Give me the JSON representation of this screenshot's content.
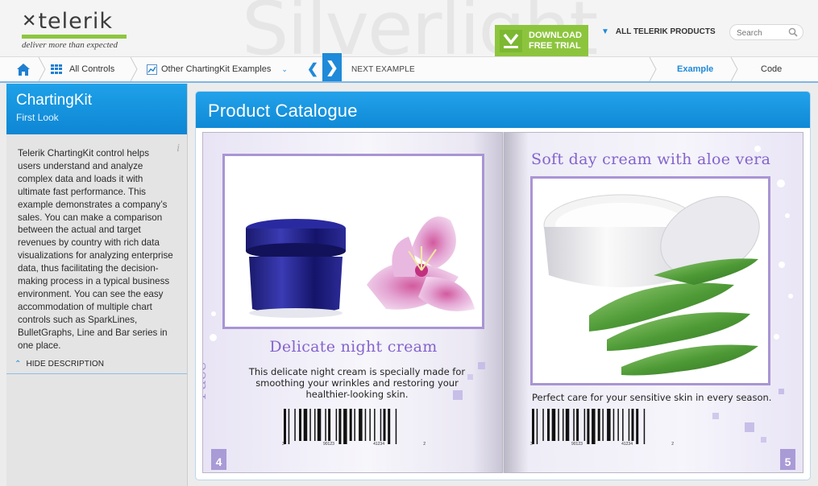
{
  "header": {
    "watermark": "Silverlight",
    "logo_word": "telerik",
    "logo_tagline": "deliver more than expected",
    "download_line1": "DOWNLOAD",
    "download_line2": "FREE TRIAL",
    "products_label": "ALL TELERIK PRODUCTS",
    "search_placeholder": "Search"
  },
  "nav": {
    "all_controls": "All Controls",
    "other_examples": "Other ChartingKit Examples",
    "next_example": "NEXT EXAMPLE",
    "tab_example": "Example",
    "tab_code": "Code"
  },
  "sidebar": {
    "title": "ChartingKit",
    "subtitle": "First Look",
    "description": "Telerik ChartingKit control helps users understand and analyze complex data and loads it with ultimate fast performance. This example demonstrates a company’s sales. You can make a comparison between the actual and target revenues by country with rich data visualizations for analyzing enterprise data, thus facilitating the decision-making process in a typical business environment. You can see the easy accommodation of multiple chart controls such as SparkLines, BulletGraphs, Line and Bar series in one place.",
    "hide_description": "HIDE DESCRIPTION"
  },
  "catalogue": {
    "title": "Product Catalogue",
    "left_page": {
      "product_title": "Delicate night cream",
      "description": "This delicate night cream is specially made for smoothing your wrinkles and restoring your healthier-looking skin.",
      "side_label": "Face",
      "page_number": "4",
      "barcode_digits": [
        "3",
        "90123",
        "41234",
        "2"
      ]
    },
    "right_page": {
      "product_title": "Soft day cream with aloe vera",
      "description": "Perfect care for your sensitive skin in every season.",
      "page_number": "5",
      "barcode_digits": [
        "3",
        "90123",
        "41234",
        "2"
      ]
    }
  },
  "colors": {
    "accent_blue": "#1f8ad9",
    "download_green": "#8cc53d",
    "catalogue_purple": "#8463cc"
  }
}
